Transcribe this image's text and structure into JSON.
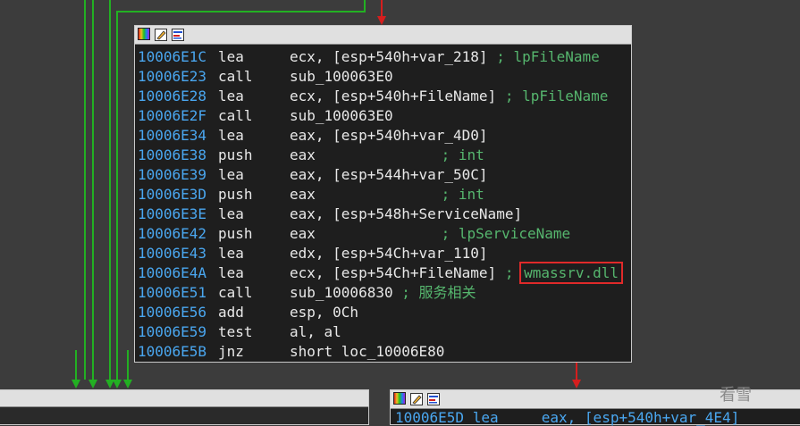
{
  "main_block": {
    "lines": [
      {
        "addr": "10006E1C",
        "mnem": "lea",
        "ops": "ecx, [esp+540h+var_218]",
        "comment": "; lpFileName"
      },
      {
        "addr": "10006E23",
        "mnem": "call",
        "ops": "sub_100063E0",
        "comment": ""
      },
      {
        "addr": "10006E28",
        "mnem": "lea",
        "ops": "ecx, [esp+540h+FileName]",
        "comment": "; lpFileName"
      },
      {
        "addr": "10006E2F",
        "mnem": "call",
        "ops": "sub_100063E0",
        "comment": ""
      },
      {
        "addr": "10006E34",
        "mnem": "lea",
        "ops": "eax, [esp+540h+var_4D0]",
        "comment": ""
      },
      {
        "addr": "10006E38",
        "mnem": "push",
        "ops": "eax",
        "comment": "; int"
      },
      {
        "addr": "10006E39",
        "mnem": "lea",
        "ops": "eax, [esp+544h+var_50C]",
        "comment": ""
      },
      {
        "addr": "10006E3D",
        "mnem": "push",
        "ops": "eax",
        "comment": "; int"
      },
      {
        "addr": "10006E3E",
        "mnem": "lea",
        "ops": "eax, [esp+548h+ServiceName]",
        "comment": ""
      },
      {
        "addr": "10006E42",
        "mnem": "push",
        "ops": "eax",
        "comment": "; lpServiceName"
      },
      {
        "addr": "10006E43",
        "mnem": "lea",
        "ops": "edx, [esp+54Ch+var_110]",
        "comment": ""
      },
      {
        "addr": "10006E4A",
        "mnem": "lea",
        "ops": "ecx, [esp+54Ch+FileName]",
        "comment": "; ",
        "highlight": "wmassrv.dll"
      },
      {
        "addr": "10006E51",
        "mnem": "call",
        "ops": "sub_10006830",
        "comment": "; 服务相关"
      },
      {
        "addr": "10006E56",
        "mnem": "add",
        "ops": "esp, 0Ch",
        "comment": ""
      },
      {
        "addr": "10006E59",
        "mnem": "test",
        "ops": "al, al",
        "comment": ""
      },
      {
        "addr": "10006E5B",
        "mnem": "jnz",
        "ops": "short loc_10006E80",
        "comment": ""
      }
    ]
  },
  "bottom_block": {
    "partial_line": "10006E5D lea     eax, [esp+540h+var_4E4]"
  },
  "watermark": "看雪",
  "icons": [
    "color-palette-icon",
    "edit-icon",
    "graph-overview-icon"
  ],
  "colors": {
    "background": "#3c3c3c",
    "address": "#4aa7f0",
    "comment": "#56b66e",
    "true_edge": "#22b022",
    "false_edge": "#d61e1e",
    "highlight_box": "#e02a2a"
  }
}
